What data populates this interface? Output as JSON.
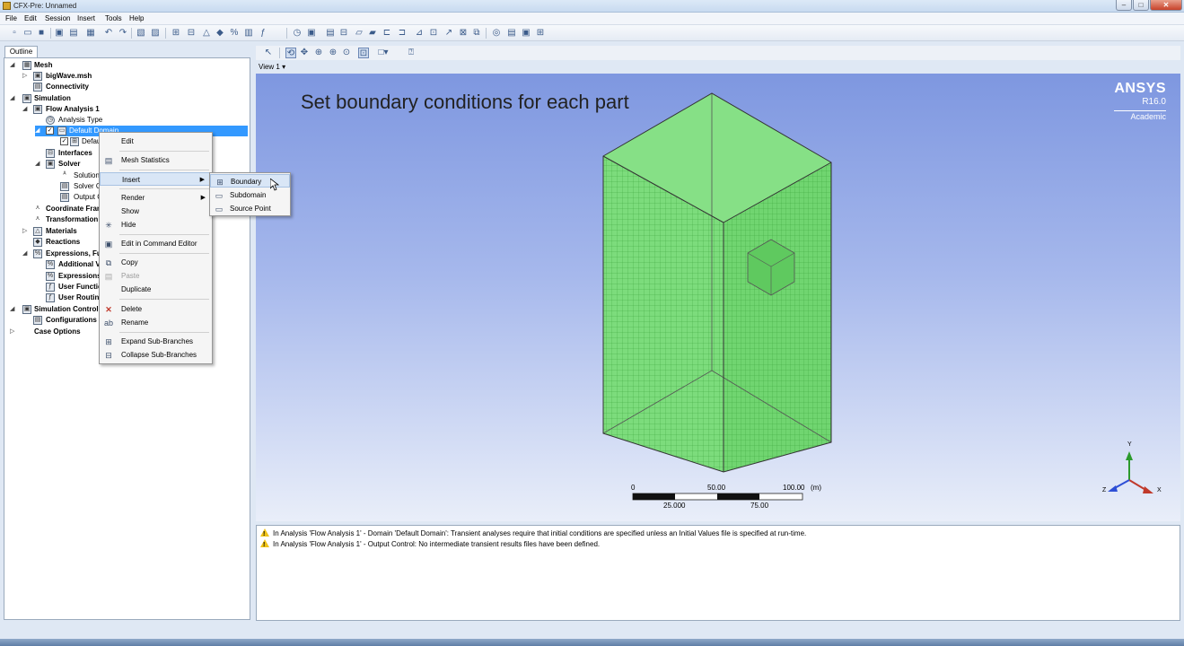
{
  "window": {
    "title": "CFX-Pre: Unnamed",
    "min": "–",
    "max": "□",
    "close": "✕"
  },
  "menu": [
    "File",
    "Edit",
    "Session",
    "Insert",
    "Tools",
    "Help"
  ],
  "outline_tab": "Outline",
  "tree": [
    {
      "label": "Mesh",
      "bold": true
    },
    {
      "label": "bigWave.msh",
      "bold": true
    },
    {
      "label": "Connectivity",
      "bold": true
    },
    {
      "label": "Simulation",
      "bold": true
    },
    {
      "label": "Flow Analysis 1",
      "bold": true
    },
    {
      "label": "Analysis Type",
      "bold": false
    },
    {
      "label": "Default Domain",
      "bold": false
    },
    {
      "label": "Defau",
      "bold": false
    },
    {
      "label": "Interfaces",
      "bold": true
    },
    {
      "label": "Solver",
      "bold": true
    },
    {
      "label": "Solution U",
      "bold": false
    },
    {
      "label": "Solver Con",
      "bold": false
    },
    {
      "label": "Output Co",
      "bold": false
    },
    {
      "label": "Coordinate Fran",
      "bold": true
    },
    {
      "label": "Transformation",
      "bold": true
    },
    {
      "label": "Materials",
      "bold": true
    },
    {
      "label": "Reactions",
      "bold": true
    },
    {
      "label": "Expressions, Fu",
      "bold": true
    },
    {
      "label": "Additional V",
      "bold": true
    },
    {
      "label": "Expressions",
      "bold": true
    },
    {
      "label": "User Functic",
      "bold": true
    },
    {
      "label": "User Routin",
      "bold": true
    },
    {
      "label": "Simulation Control",
      "bold": true
    },
    {
      "label": "Configurations",
      "bold": true
    },
    {
      "label": "Case Options",
      "bold": true
    }
  ],
  "context_menu": [
    "Edit",
    "Mesh Statistics",
    "Insert",
    "Render",
    "Show",
    "Hide",
    "Edit in Command Editor",
    "Copy",
    "Paste",
    "Duplicate",
    "Delete",
    "Rename",
    "Expand Sub-Branches",
    "Collapse Sub-Branches"
  ],
  "insert_submenu": [
    "Boundary",
    "Subdomain",
    "Source Point"
  ],
  "viewport": {
    "tab": "View 1",
    "annotation": "Set boundary conditions for each part",
    "brand": {
      "name": "ANSYS",
      "version": "R16.0",
      "edition": "Academic"
    },
    "scale": {
      "top": [
        "0",
        "50.00",
        "100.00",
        "(m)"
      ],
      "bottom": [
        "25.000",
        "75.00"
      ]
    },
    "triad": {
      "y": "Y",
      "x": "X",
      "z": "Z"
    }
  },
  "messages": [
    "In Analysis 'Flow Analysis 1' - Domain 'Default Domain': Transient analyses require that initial conditions are specified unless an Initial Values file is specified at run-time.",
    "In Analysis 'Flow Analysis 1' - Output Control: No intermediate transient results files have been defined."
  ],
  "colors": {
    "mesh": "#6fd36f",
    "selection": "#3399ff",
    "warning": "#f0c419"
  }
}
